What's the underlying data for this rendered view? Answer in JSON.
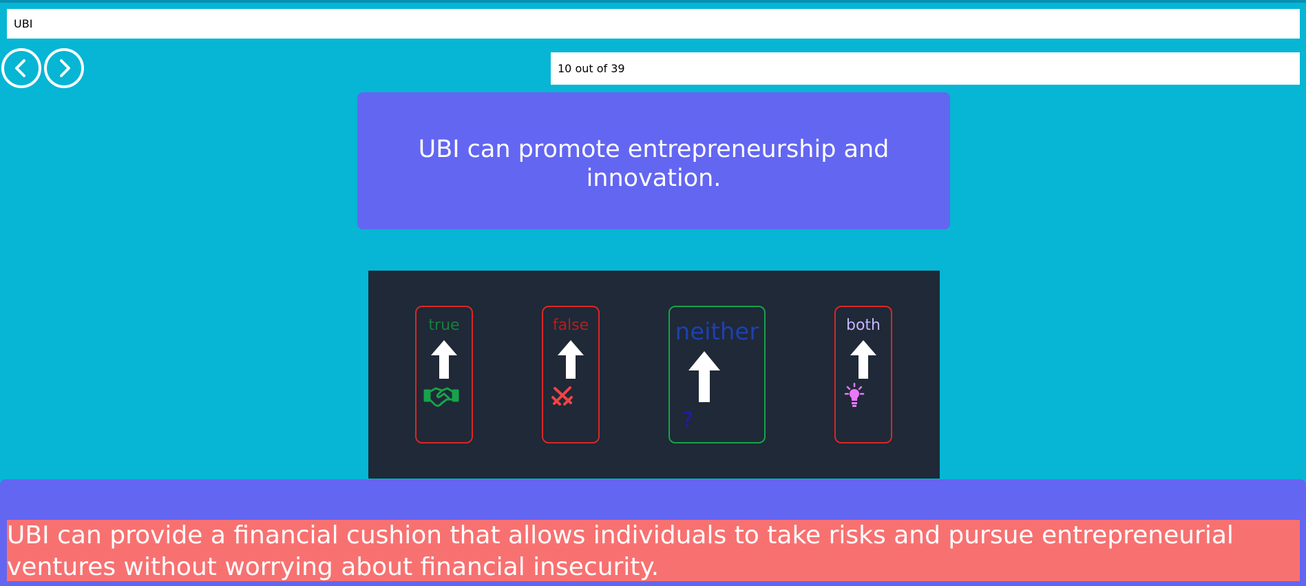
{
  "topic_input": {
    "value": "UBI"
  },
  "navigation": {
    "prev_icon": "chevron-left-icon",
    "next_icon": "chevron-right-icon"
  },
  "counter": {
    "text": "10 out of 39"
  },
  "statement": {
    "text": "UBI can promote entrepreneurship and innovation."
  },
  "choices": [
    {
      "label": "true",
      "icon": "handshake-icon",
      "label_color": "#15803d",
      "border_color": "#dc2626"
    },
    {
      "label": "false",
      "icon": "crossed-swords-icon",
      "label_color": "#b91c1c",
      "border_color": "#dc2626"
    },
    {
      "label": "neither",
      "icon": "question-mark-icon",
      "symbol": "?",
      "label_color": "#1e40af",
      "border_color": "#16a34a"
    },
    {
      "label": "both",
      "icon": "lightbulb-icon",
      "label_color": "#c4b5fd",
      "border_color": "#dc2626"
    }
  ],
  "explanation": {
    "text": "UBI can provide a financial cushion that allows individuals to take risks and pursue entrepreneurial ventures without worrying about financial insecurity."
  },
  "colors": {
    "background": "#06b6d4",
    "card": "#6366f1",
    "panel": "#1f2937",
    "explanation_highlight": "#f87171"
  }
}
